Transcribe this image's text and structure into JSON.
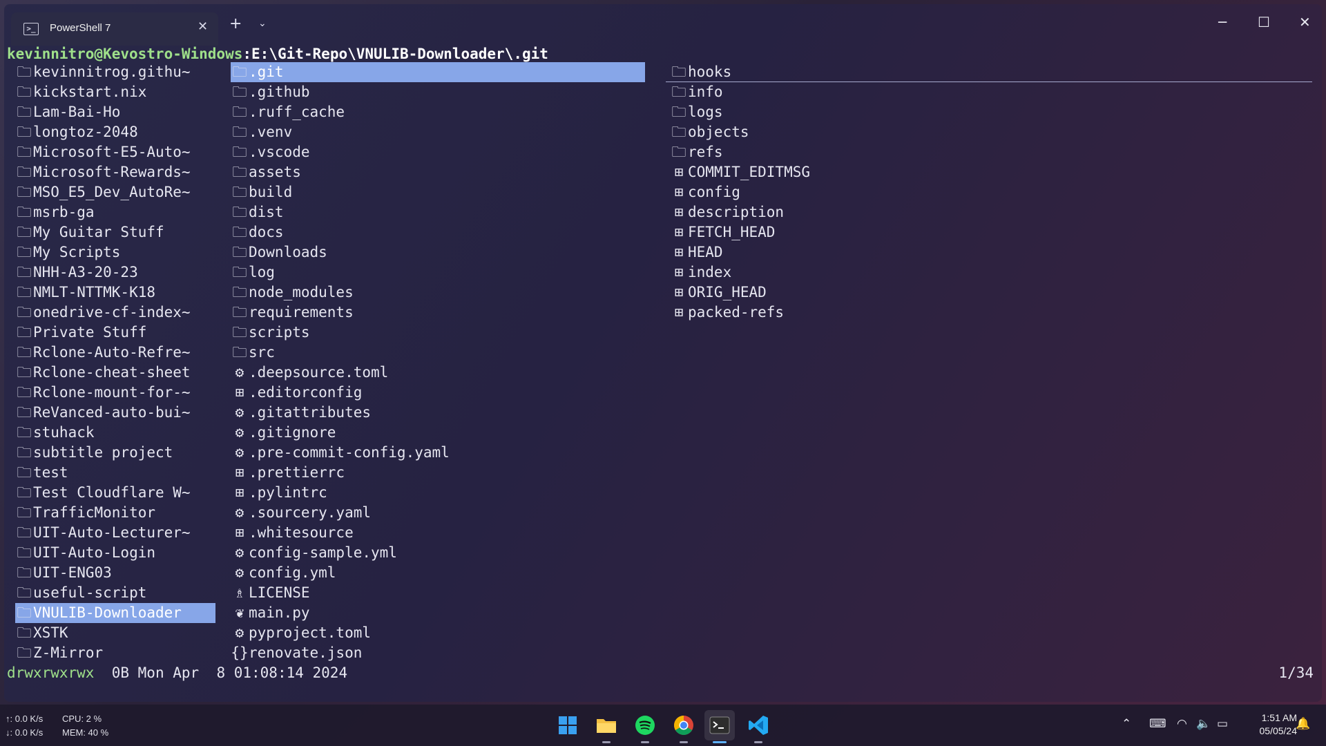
{
  "window": {
    "tab_title": "PowerShell 7",
    "tab_close": "✕",
    "new_tab": "+",
    "dropdown": "⌄",
    "controls": {
      "minimize": "─",
      "maximize": "☐",
      "close": "✕"
    }
  },
  "prompt": {
    "user_host": "kevinnitro@Kevostro-Windows",
    "separator": ":",
    "path": "E:\\Git-Repo\\VNULIB-Downloader\\.git"
  },
  "icons": {
    "folder": "folder-icon",
    "file": "file-icon",
    "gear": "gear-icon",
    "license": "license-icon",
    "python": "python-icon",
    "json": "json-icon"
  },
  "columns": {
    "parent": [
      "kevinnitrog.githu~",
      "kickstart.nix",
      "Lam-Bai-Ho",
      "longtoz-2048",
      "Microsoft-E5-Auto~",
      "Microsoft-Rewards~",
      "MSO_E5_Dev_AutoRe~",
      "msrb-ga",
      "My Guitar Stuff",
      "My Scripts",
      "NHH-A3-20-23",
      "NMLT-NTTMK-K18",
      "onedrive-cf-index~",
      "Private Stuff",
      "Rclone-Auto-Refre~",
      "Rclone-cheat-sheet",
      "Rclone-mount-for-~",
      "ReVanced-auto-bui~",
      "stuhack",
      "subtitle project",
      "test",
      "Test Cloudflare W~",
      "TrafficMonitor",
      "UIT-Auto-Lecturer~",
      "UIT-Auto-Login",
      "UIT-ENG03",
      "useful-script",
      "VNULIB-Downloader",
      "XSTK",
      "Z-Mirror"
    ],
    "current": [
      {
        "name": ".git",
        "icon": "folder"
      },
      {
        "name": ".github",
        "icon": "folder"
      },
      {
        "name": ".ruff_cache",
        "icon": "folder"
      },
      {
        "name": ".venv",
        "icon": "folder"
      },
      {
        "name": ".vscode",
        "icon": "folder"
      },
      {
        "name": "assets",
        "icon": "folder"
      },
      {
        "name": "build",
        "icon": "folder"
      },
      {
        "name": "dist",
        "icon": "folder"
      },
      {
        "name": "docs",
        "icon": "folder"
      },
      {
        "name": "Downloads",
        "icon": "folder"
      },
      {
        "name": "log",
        "icon": "folder"
      },
      {
        "name": "node_modules",
        "icon": "folder"
      },
      {
        "name": "requirements",
        "icon": "folder"
      },
      {
        "name": "scripts",
        "icon": "folder"
      },
      {
        "name": "src",
        "icon": "folder"
      },
      {
        "name": ".deepsource.toml",
        "icon": "gear"
      },
      {
        "name": ".editorconfig",
        "icon": "file"
      },
      {
        "name": ".gitattributes",
        "icon": "gear"
      },
      {
        "name": ".gitignore",
        "icon": "gear"
      },
      {
        "name": ".pre-commit-config.yaml",
        "icon": "gear"
      },
      {
        "name": ".prettierrc",
        "icon": "file"
      },
      {
        "name": ".pylintrc",
        "icon": "file"
      },
      {
        "name": ".sourcery.yaml",
        "icon": "gear"
      },
      {
        "name": ".whitesource",
        "icon": "file"
      },
      {
        "name": "config-sample.yml",
        "icon": "gear"
      },
      {
        "name": "config.yml",
        "icon": "gear"
      },
      {
        "name": "LICENSE",
        "icon": "license"
      },
      {
        "name": "main.py",
        "icon": "python"
      },
      {
        "name": "pyproject.toml",
        "icon": "gear"
      },
      {
        "name": "renovate.json",
        "icon": "json"
      }
    ],
    "preview": [
      {
        "name": "hooks",
        "icon": "folder"
      },
      {
        "name": "info",
        "icon": "folder"
      },
      {
        "name": "logs",
        "icon": "folder"
      },
      {
        "name": "objects",
        "icon": "folder"
      },
      {
        "name": "refs",
        "icon": "folder"
      },
      {
        "name": "COMMIT_EDITMSG",
        "icon": "file"
      },
      {
        "name": "config",
        "icon": "file"
      },
      {
        "name": "description",
        "icon": "file"
      },
      {
        "name": "FETCH_HEAD",
        "icon": "file"
      },
      {
        "name": "HEAD",
        "icon": "file"
      },
      {
        "name": "index",
        "icon": "file"
      },
      {
        "name": "ORIG_HEAD",
        "icon": "file"
      },
      {
        "name": "packed-refs",
        "icon": "file"
      }
    ]
  },
  "selection": {
    "parent": "VNULIB-Downloader",
    "current": ".git"
  },
  "status": {
    "permissions": "drwxrwxrwx",
    "details": "  0B Mon Apr  8 01:08:14 2024",
    "position": "1/34"
  },
  "taskbar": {
    "net_up": "↑: 0.0 K/s",
    "net_down": "↓: 0.0 K/s",
    "cpu": "CPU: 2 %",
    "mem": "MEM: 40 %",
    "apps": [
      "start-menu",
      "file-explorer",
      "spotify",
      "chrome",
      "windows-terminal",
      "vscode"
    ],
    "active_app": "windows-terminal",
    "time": "1:51 AM",
    "date": "05/05/24"
  },
  "colors": {
    "selection": "#87a6e8",
    "prompt_user": "#9fe08a",
    "permissions": "#9fe08a",
    "terminal_text": "#e6e6f0"
  }
}
